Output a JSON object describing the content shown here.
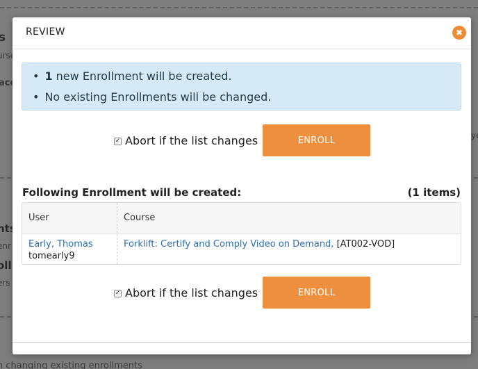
{
  "background": {
    "frag_s": "s",
    "frag_urse": "urse",
    "frag_aco": "aco",
    "frag_ye": "ye",
    "frag_nts": "nts",
    "frag_enr": "enr",
    "frag_oll": "oll",
    "frag_ers": "ers",
    "frag_bottom": "n changing existing enrollments"
  },
  "modal": {
    "title": "REVIEW",
    "close_glyph": "✖",
    "info": {
      "count": "1",
      "line1_rest": " new Enrollment will be created.",
      "line2": "No existing Enrollments will be changed."
    },
    "abort_label": "Abort if the list changes",
    "enroll_label": "ENROLL",
    "list_title": "Following Enrollment will be created:",
    "list_count": "(1 items)",
    "table": {
      "headers": {
        "user": "User",
        "course": "Course"
      },
      "rows": [
        {
          "user_name": "Early, Thomas",
          "user_login": "tomearly9",
          "course_name": "Forklift: Certify and Comply Video on Demand,",
          "course_code": "[AT002-VOD]"
        }
      ]
    }
  },
  "colors": {
    "accent": "#ee8f40",
    "info_bg": "#d5eaf6",
    "link": "#2d6fb3"
  }
}
